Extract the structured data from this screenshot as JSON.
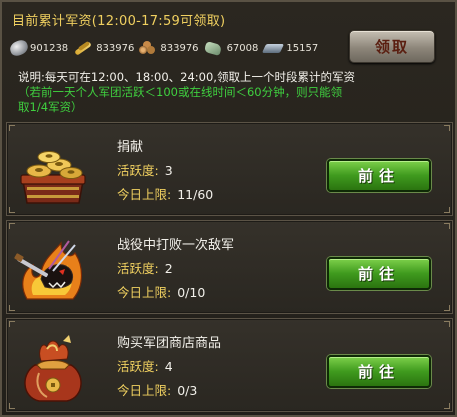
{
  "header": {
    "title": "目前累计军资(12:00-17:59可领取)",
    "claim_label": "领取"
  },
  "resources": [
    {
      "icon": "silver-icon",
      "value": "901238"
    },
    {
      "icon": "grain-icon",
      "value": "833976"
    },
    {
      "icon": "wood-icon",
      "value": "833976"
    },
    {
      "icon": "stone-icon",
      "value": "67008"
    },
    {
      "icon": "iron-icon",
      "value": "15157"
    }
  ],
  "description": {
    "line1": "说明:每天可在12:00、18:00、24:00,领取上一个时段累计的军资",
    "line2": "（若前一天个人军团活跃＜100或在线时间＜60分钟，则只能领",
    "line3": "取1/4军资）"
  },
  "tasks": [
    {
      "name": "捐献",
      "activity_label": "活跃度:",
      "activity": "3",
      "limit_label": "今日上限:",
      "limit": "11/60",
      "button": "前往",
      "icon": "treasure-chest-icon"
    },
    {
      "name": "战役中打败一次敌军",
      "activity_label": "活跃度:",
      "activity": "2",
      "limit_label": "今日上限:",
      "limit": "0/10",
      "button": "前往",
      "icon": "flaming-beast-icon"
    },
    {
      "name": "购买军团商店商品",
      "activity_label": "活跃度:",
      "activity": "4",
      "limit_label": "今日上限:",
      "limit": "0/3",
      "button": "前往",
      "icon": "money-bag-icon"
    }
  ],
  "colors": {
    "title": "#f0d060",
    "notice_green": "#3fcf3f",
    "button_green": "#3f9a1e"
  }
}
